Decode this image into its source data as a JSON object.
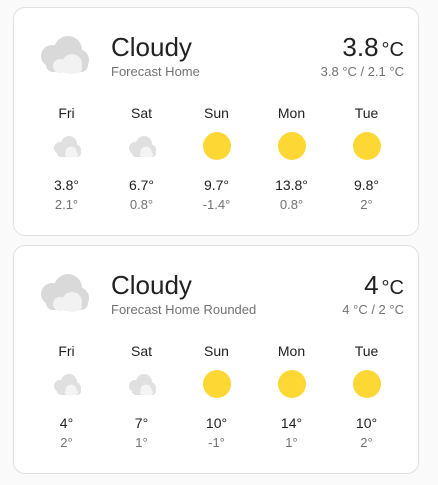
{
  "cards": [
    {
      "condition": "Cloudy",
      "friendly_name": "Forecast Home",
      "temperature": "3.8",
      "unit": "°C",
      "attribute": "3.8 °C / 2.1 °C",
      "condition_icon": "cloudy-icon",
      "forecast": [
        {
          "day": "Fri",
          "icon": "cloudy-icon",
          "high": "3.8°",
          "low": "2.1°"
        },
        {
          "day": "Sat",
          "icon": "cloudy-icon",
          "high": "6.7°",
          "low": "0.8°"
        },
        {
          "day": "Sun",
          "icon": "sunny-icon",
          "high": "9.7°",
          "low": "-1.4°"
        },
        {
          "day": "Mon",
          "icon": "sunny-icon",
          "high": "13.8°",
          "low": "0.8°"
        },
        {
          "day": "Tue",
          "icon": "sunny-icon",
          "high": "9.8°",
          "low": "2°"
        }
      ]
    },
    {
      "condition": "Cloudy",
      "friendly_name": "Forecast Home Rounded",
      "temperature": "4",
      "unit": "°C",
      "attribute": "4 °C / 2 °C",
      "condition_icon": "cloudy-icon",
      "forecast": [
        {
          "day": "Fri",
          "icon": "cloudy-icon",
          "high": "4°",
          "low": "2°"
        },
        {
          "day": "Sat",
          "icon": "cloudy-icon",
          "high": "7°",
          "low": "1°"
        },
        {
          "day": "Sun",
          "icon": "sunny-icon",
          "high": "10°",
          "low": "-1°"
        },
        {
          "day": "Mon",
          "icon": "sunny-icon",
          "high": "14°",
          "low": "1°"
        },
        {
          "day": "Tue",
          "icon": "sunny-icon",
          "high": "10°",
          "low": "2°"
        }
      ]
    }
  ],
  "colors": {
    "cloud": "#d9d9d9",
    "cloud_small": "#e0e0e0",
    "sun": "#fdd835"
  }
}
